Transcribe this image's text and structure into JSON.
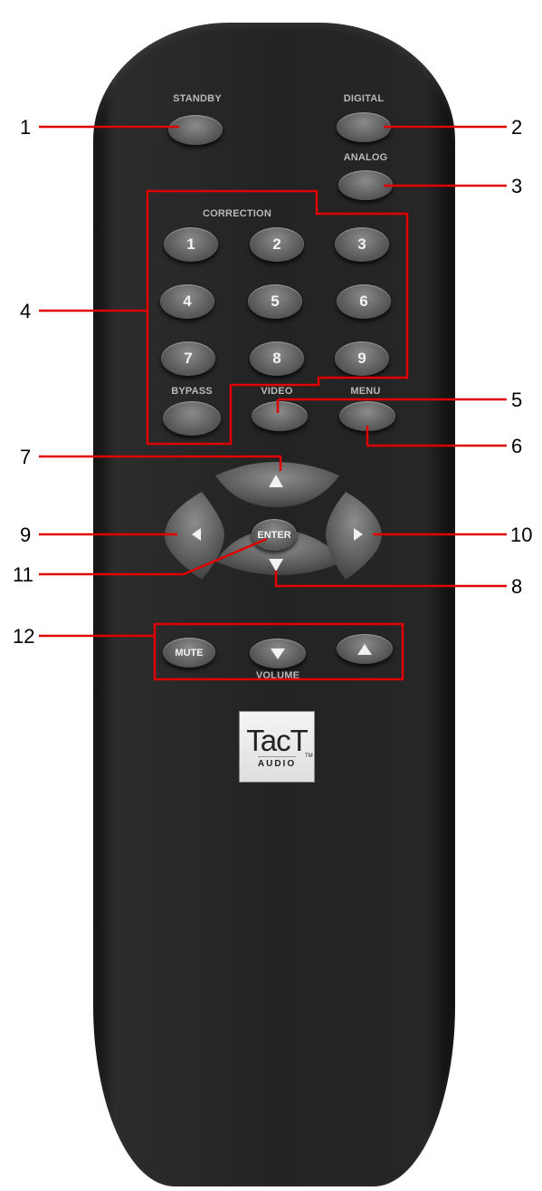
{
  "labels": {
    "standby": "STANDBY",
    "digital": "DIGITAL",
    "analog": "ANALOG",
    "correction": "CORRECTION",
    "bypass": "BYPASS",
    "video": "VIDEO",
    "menu": "MENU",
    "enter": "ENTER",
    "mute": "MUTE",
    "volume": "VOLUME"
  },
  "number_keys": [
    "1",
    "2",
    "3",
    "4",
    "5",
    "6",
    "7",
    "8",
    "9"
  ],
  "logo": {
    "title": "TacT",
    "subtitle": "AUDIO",
    "mark": "TM"
  },
  "callouts": [
    "1",
    "2",
    "3",
    "4",
    "5",
    "6",
    "7",
    "8",
    "9",
    "10",
    "11",
    "12"
  ],
  "colors": {
    "callout_line": "#e00000",
    "button": "#6a6a6a",
    "remote_body": "#242424"
  }
}
